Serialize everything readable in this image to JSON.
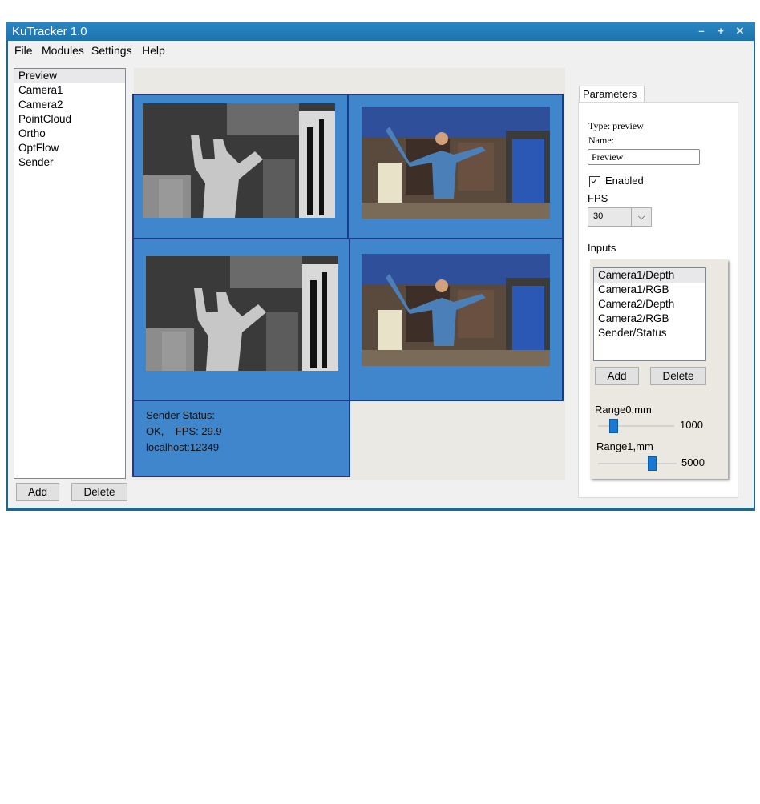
{
  "window": {
    "title": "KuTracker 1.0"
  },
  "menu": [
    "File",
    "Modules",
    "Settings",
    "Help"
  ],
  "modules": {
    "items": [
      "Preview",
      "Camera1",
      "Camera2",
      "PointCloud",
      "Ortho",
      "OptFlow",
      "Sender"
    ],
    "selected": "Preview",
    "add_label": "Add",
    "delete_label": "Delete"
  },
  "sender_status": {
    "line1": "Sender Status:",
    "line2": "OK,    FPS: 29.9",
    "line3": "localhost:12349"
  },
  "parameters": {
    "tab_label": "Parameters",
    "type_text": "Type: preview",
    "name_label": "Name:",
    "name_value": "Preview",
    "enabled_label": "Enabled",
    "enabled_checked": true,
    "fps_label": "FPS",
    "fps_value": "30",
    "inputs_label": "Inputs",
    "inputs": [
      "Camera1/Depth",
      "Camera1/RGB",
      "Camera2/Depth",
      "Camera2/RGB",
      "Sender/Status"
    ],
    "inputs_selected": "Camera1/Depth",
    "add_label": "Add",
    "delete_label": "Delete",
    "range0_label": "Range0,mm",
    "range0_value": "1000",
    "range1_label": "Range1,mm",
    "range1_value": "5000"
  },
  "colors": {
    "titlebar": "#1d73ad",
    "panel": "#3f86cc",
    "panel_border": "#1c3a8a",
    "slider": "#1979d4"
  }
}
